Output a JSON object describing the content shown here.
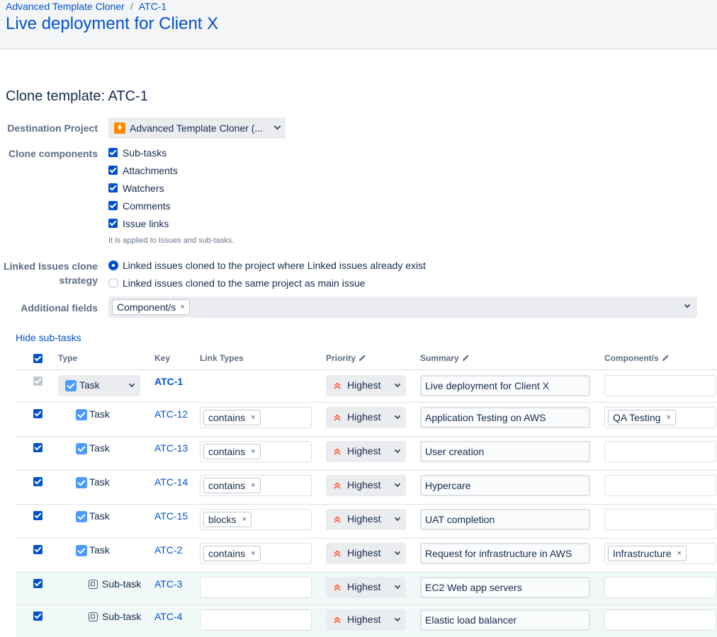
{
  "breadcrumb": {
    "project": "Advanced Template Cloner",
    "separator": "/",
    "issue": "ATC-1"
  },
  "page_title": "Live deployment for Client X",
  "section_title": "Clone template: ATC-1",
  "form": {
    "destination_label": "Destination Project",
    "destination_value": "Advanced Template Cloner (...",
    "components_label": "Clone components",
    "components": [
      "Sub-tasks",
      "Attachments",
      "Watchers",
      "Comments",
      "Issue links"
    ],
    "components_hint": "It is applied to Issues and sub-tasks.",
    "strategy_label_1": "Linked Issues clone",
    "strategy_label_2": "strategy",
    "strategy_options": [
      {
        "label": "Linked issues cloned to the project where Linked issues already exist",
        "selected": true
      },
      {
        "label": "Linked issues cloned to the same project as main issue",
        "selected": false
      }
    ],
    "additional_label": "Additional fields",
    "additional_tag": "Component/s",
    "tag_remove": "×"
  },
  "hide_subtasks": "Hide sub-tasks",
  "table": {
    "headers": {
      "type": "Type",
      "key": "Key",
      "link_types": "Link Types",
      "priority": "Priority",
      "summary": "Summary",
      "components": "Component/s"
    },
    "rows": [
      {
        "type": "Task",
        "key": "ATC-1",
        "link": "",
        "priority": "Highest",
        "summary": "Live deployment for Client X",
        "component": ""
      },
      {
        "type": "Task",
        "key": "ATC-12",
        "link": "contains",
        "priority": "Highest",
        "summary": "Application Testing on AWS",
        "component": "QA Testing"
      },
      {
        "type": "Task",
        "key": "ATC-13",
        "link": "contains",
        "priority": "Highest",
        "summary": "User creation",
        "component": ""
      },
      {
        "type": "Task",
        "key": "ATC-14",
        "link": "contains",
        "priority": "Highest",
        "summary": "Hypercare",
        "component": ""
      },
      {
        "type": "Task",
        "key": "ATC-15",
        "link": "blocks",
        "priority": "Highest",
        "summary": "UAT completion",
        "component": ""
      },
      {
        "type": "Task",
        "key": "ATC-2",
        "link": "contains",
        "priority": "Highest",
        "summary": "Request for infrastructure in AWS",
        "component": "Infrastructure"
      },
      {
        "type": "Sub-task",
        "key": "ATC-3",
        "link": "",
        "priority": "Highest",
        "summary": "EC2 Web app servers",
        "component": ""
      },
      {
        "type": "Sub-task",
        "key": "ATC-4",
        "link": "",
        "priority": "Highest",
        "summary": "Elastic load balancer",
        "component": ""
      }
    ]
  },
  "colors": {
    "link": "#0052cc",
    "priority": "#ff5630",
    "subtask_row_bg": "#f0f9f8"
  }
}
